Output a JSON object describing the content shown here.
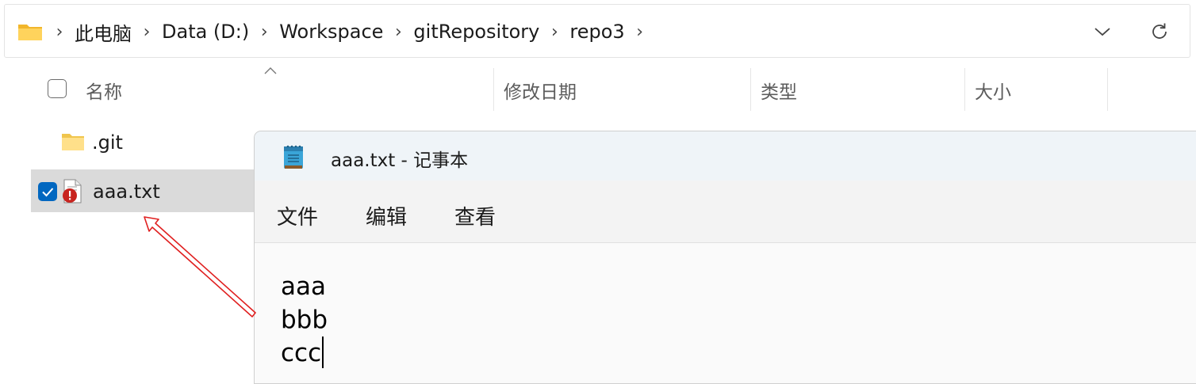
{
  "explorer": {
    "breadcrumbs": [
      "此电脑",
      "Data (D:)",
      "Workspace",
      "gitRepository",
      "repo3"
    ],
    "columns": {
      "name": "名称",
      "modified": "修改日期",
      "type": "类型",
      "size": "大小"
    },
    "files": [
      {
        "name": ".git",
        "icon": "folder-icon",
        "selected": false
      },
      {
        "name": "aaa.txt",
        "icon": "text-file-conflict-icon",
        "selected": true
      }
    ]
  },
  "notepad": {
    "title": "aaa.txt - 记事本",
    "menu": [
      "文件",
      "编辑",
      "查看"
    ],
    "content_lines": [
      "aaa",
      "bbb",
      "ccc"
    ]
  },
  "colors": {
    "accent": "#0067c0",
    "selected_row": "#dadada",
    "annotation_arrow": "#e02020",
    "folder": "#f5c342"
  }
}
